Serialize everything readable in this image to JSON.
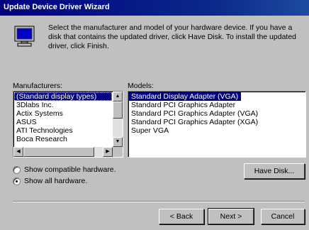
{
  "window": {
    "title": "Update Device Driver Wizard"
  },
  "intro": {
    "text": "Select the manufacturer and model of your hardware device. If you have a disk that contains the updated driver, click Have Disk. To install the updated driver, click Finish.",
    "icon": "monitor-icon"
  },
  "manufacturers": {
    "label": "Manufacturers:",
    "items": [
      "(Standard display types)",
      "3Dlabs Inc.",
      "Actix Systems",
      "ASUS",
      "ATI Technologies",
      "Boca Research"
    ],
    "selected_index": 0
  },
  "models": {
    "label": "Models:",
    "items": [
      "Standard Display Adapter (VGA)",
      "Standard PCI Graphics Adapter",
      "Standard PCI Graphics Adapter (VGA)",
      "Standard PCI Graphics Adapter (XGA)",
      "Super VGA"
    ],
    "selected_index": 0
  },
  "options": {
    "show_compatible": "Show compatible hardware.",
    "show_all": "Show all hardware.",
    "selected": "show_all"
  },
  "buttons": {
    "have_disk": "Have Disk...",
    "back": "< Back",
    "next": "Next >",
    "cancel": "Cancel"
  }
}
